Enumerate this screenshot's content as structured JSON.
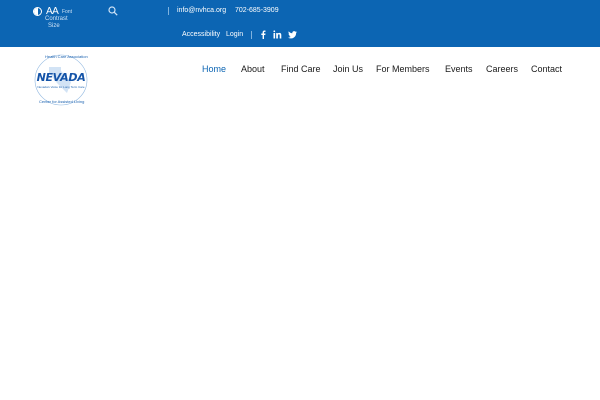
{
  "topbar": {
    "accessibility_tools": {
      "contrast_icon": "contrast-icon",
      "font_glyph": "AA",
      "font_label": "Font",
      "contrast_label": "Contrast",
      "size_label": "Size"
    },
    "search_icon": "search-icon",
    "email": "info@nvhca.org",
    "phone": "702-685-3909",
    "accessibility_link": "Accessibility",
    "login_link": "Login",
    "social": [
      "facebook-icon",
      "linkedin-icon",
      "twitter-icon"
    ],
    "background_color": "#0c65b3"
  },
  "logo": {
    "arc_top": "Health Care Association",
    "main": "NEVADA",
    "tagline": "Nevada's Voice for Long Term Care",
    "arc_bottom": "Center for Assisted Living"
  },
  "nav": {
    "items": [
      {
        "label": "Home",
        "active": true
      },
      {
        "label": "About",
        "active": false
      },
      {
        "label": "Find Care",
        "active": false
      },
      {
        "label": "Join Us",
        "active": false
      },
      {
        "label": "For Members",
        "active": false
      },
      {
        "label": "Events",
        "active": false
      },
      {
        "label": "Careers",
        "active": false
      },
      {
        "label": "Contact",
        "active": false
      }
    ],
    "active_color": "#0c65b3"
  }
}
